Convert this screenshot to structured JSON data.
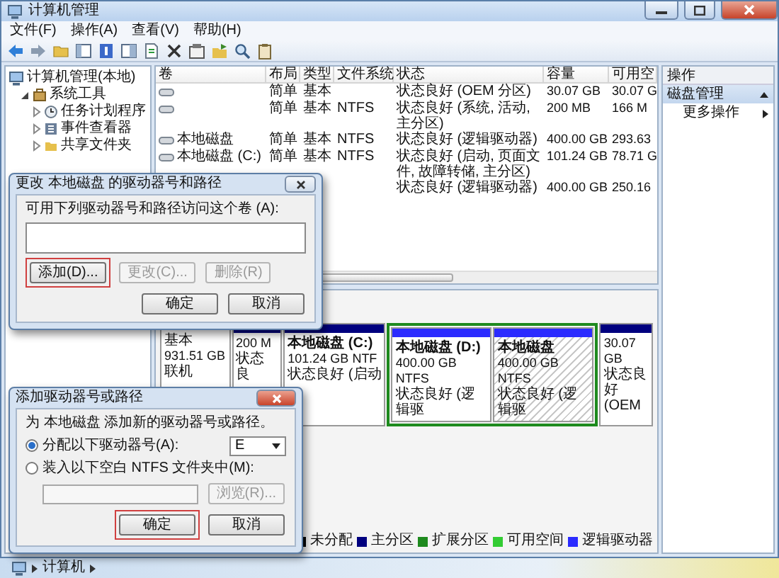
{
  "window": {
    "title": "计算机管理"
  },
  "menu": [
    "文件(F)",
    "操作(A)",
    "查看(V)",
    "帮助(H)"
  ],
  "tree": [
    {
      "label": "计算机管理(本地)",
      "children": [
        {
          "label": "系统工具",
          "expanded": true,
          "children": [
            {
              "label": "任务计划程序",
              "expanded": false
            },
            {
              "label": "事件查看器",
              "expanded": false
            },
            {
              "label": "共享文件夹",
              "expanded": false
            }
          ]
        }
      ]
    }
  ],
  "table": {
    "columns": [
      "卷",
      "布局",
      "类型",
      "文件系统",
      "状态",
      "容量",
      "可用空"
    ],
    "rows": [
      {
        "layout": "简单",
        "type": "基本",
        "status": "状态良好 (OEM 分区)",
        "capacity": "30.07 GB",
        "free": "30.07 G"
      },
      {
        "layout": "简单",
        "type": "基本",
        "file_system": "NTFS",
        "status": "状态良好 (系统, 活动, 主分区)",
        "capacity": "200 MB",
        "free": "166 M"
      },
      {
        "volume": "本地磁盘",
        "layout": "简单",
        "type": "基本",
        "file_system": "NTFS",
        "status": "状态良好 (逻辑驱动器)",
        "capacity": "400.00 GB",
        "free": "293.63"
      },
      {
        "volume": "本地磁盘 (C:)",
        "layout": "简单",
        "type": "基本",
        "file_system": "NTFS",
        "status": "状态良好 (启动, 页面文件, 故障转储, 主分区)",
        "capacity": "101.24 GB",
        "free": "78.71 G"
      },
      {
        "status": "状态良好 (逻辑驱动器)",
        "capacity": "400.00 GB",
        "free": "250.16"
      }
    ]
  },
  "actions": {
    "title": "操作",
    "sections": [
      {
        "label": "磁盘管理",
        "expanded": true,
        "items": [
          "更多操作"
        ]
      }
    ]
  },
  "disks": [
    {
      "label_lines": [
        "基本",
        "931.51 GB",
        "联机"
      ],
      "partitions": [
        {
          "kind": "primary",
          "selected": false,
          "lines": [
            "200 M",
            "状态良"
          ]
        },
        {
          "kind": "primary",
          "selected": false,
          "name": "本地磁盘 (C:)",
          "lines": [
            "101.24 GB NTF",
            "状态良好 (启动"
          ]
        },
        {
          "kind": "extended",
          "children": [
            {
              "kind": "logical",
              "selected": false,
              "name": "本地磁盘 (D:)",
              "lines": [
                "400.00 GB NTFS",
                "状态良好 (逻辑驱"
              ]
            },
            {
              "kind": "logical",
              "selected": true,
              "name": "本地磁盘",
              "lines": [
                "400.00 GB NTFS",
                "状态良好 (逻辑驱"
              ]
            }
          ]
        },
        {
          "kind": "primary",
          "selected": false,
          "lines": [
            "30.07 GB",
            "状态良好 (OEM"
          ]
        }
      ]
    }
  ],
  "legend": [
    {
      "label": "未分配",
      "color": "#000000"
    },
    {
      "label": "主分区",
      "color": "#00007f"
    },
    {
      "label": "扩展分区",
      "color": "#1e8a1e"
    },
    {
      "label": "可用空间",
      "color": "#33cc33"
    },
    {
      "label": "逻辑驱动器",
      "color": "#2b2bff"
    }
  ],
  "change_dialog": {
    "title": "更改 本地磁盘 的驱动器号和路径",
    "label": "可用下列驱动器号和路径访问这个卷 (A):",
    "buttons": [
      {
        "label": "添加(D)...",
        "disabled": false,
        "highlighted": true
      },
      {
        "label": "更改(C)...",
        "disabled": true,
        "highlighted": false
      },
      {
        "label": "删除(R)",
        "disabled": true,
        "highlighted": false
      }
    ],
    "footer_buttons": [
      {
        "label": "确定",
        "highlighted": false
      },
      {
        "label": "取消",
        "highlighted": false
      }
    ]
  },
  "add_dialog": {
    "title": "添加驱动器号或路径",
    "prompt": "为 本地磁盘 添加新的驱动器号或路径。",
    "options": [
      {
        "kind": "letter",
        "label": "分配以下驱动器号(A):",
        "selected": true,
        "value": "E"
      },
      {
        "kind": "folder",
        "label": "装入以下空白 NTFS 文件夹中(M):",
        "selected": false,
        "button": {
          "label": "浏览(R)...",
          "disabled": true
        }
      }
    ],
    "buttons": [
      {
        "label": "确定",
        "highlighted": true
      },
      {
        "label": "取消",
        "highlighted": false
      }
    ]
  },
  "taskbar": {
    "breadcrumb": "计算机"
  }
}
